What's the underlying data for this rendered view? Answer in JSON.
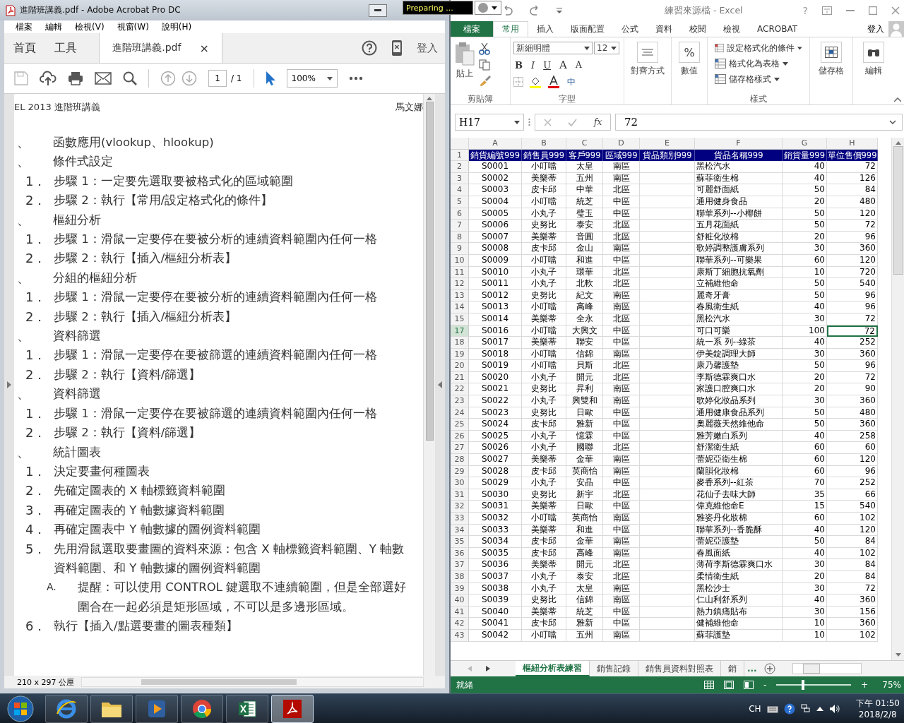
{
  "acrobat": {
    "title": "進階班講義.pdf - Adobe Acrobat Pro DC",
    "menu": [
      "檔案",
      "編輯",
      "檢視(V)",
      "視窗(W)",
      "說明(H)"
    ],
    "tabs": [
      {
        "label": "首頁",
        "selected": false
      },
      {
        "label": "工具",
        "selected": false
      },
      {
        "label": "進階班講義.pdf",
        "selected": true,
        "close": "×"
      }
    ],
    "sign_in": "登入",
    "page_number": "1",
    "page_total": "/ 1",
    "zoom": "100%",
    "page": {
      "header_left": "EL 2013 進階班講義",
      "header_right": "馬文娜",
      "items": [
        {
          "kind": "heading",
          "marker": "、",
          "lines": [
            "函數應用(vlookup、hlookup)"
          ]
        },
        {
          "kind": "heading",
          "marker": "、",
          "lines": [
            "條件式設定"
          ]
        },
        {
          "kind": "step",
          "marker": "1．",
          "lines": [
            "步驟 1：一定要先選取要被格式化的區域範圍"
          ]
        },
        {
          "kind": "step",
          "marker": "2．",
          "lines": [
            "步驟 2：執行【常用/設定格式化的條件】"
          ]
        },
        {
          "kind": "heading",
          "marker": "、",
          "lines": [
            "樞紐分析"
          ]
        },
        {
          "kind": "step",
          "marker": "1．",
          "lines": [
            "步驟 1：滑鼠一定要停在要被分析的連續資料範圍內任何一格"
          ]
        },
        {
          "kind": "step",
          "marker": "2．",
          "lines": [
            "步驟 2：執行【插入/樞紐分析表】"
          ]
        },
        {
          "kind": "heading",
          "marker": "、",
          "lines": [
            "分組的樞紐分析"
          ]
        },
        {
          "kind": "step",
          "marker": "1．",
          "lines": [
            "步驟 1：滑鼠一定要停在要被分析的連續資料範圍內任何一格"
          ]
        },
        {
          "kind": "step",
          "marker": "2．",
          "lines": [
            "步驟 2：執行【插入/樞紐分析表】"
          ]
        },
        {
          "kind": "heading",
          "marker": "、",
          "lines": [
            "資料篩選"
          ]
        },
        {
          "kind": "step",
          "marker": "1．",
          "lines": [
            "步驟 1：滑鼠一定要停在要被篩選的連續資料範圍內任何一格"
          ]
        },
        {
          "kind": "step",
          "marker": "2．",
          "lines": [
            "步驟 2：執行【資料/篩選】"
          ]
        },
        {
          "kind": "heading",
          "marker": "、",
          "lines": [
            "資料篩選"
          ]
        },
        {
          "kind": "step",
          "marker": "1．",
          "lines": [
            "步驟 1：滑鼠一定要停在要被篩選的連續資料範圍內任何一格"
          ]
        },
        {
          "kind": "step",
          "marker": "2．",
          "lines": [
            "步驟 2：執行【資料/篩選】"
          ]
        },
        {
          "kind": "heading",
          "marker": "、",
          "lines": [
            "統計圖表"
          ]
        },
        {
          "kind": "step",
          "marker": "1．",
          "lines": [
            "決定要畫何種圖表"
          ]
        },
        {
          "kind": "step",
          "marker": "2．",
          "lines": [
            "先確定圖表的 X 軸標籤資料範圍"
          ]
        },
        {
          "kind": "step",
          "marker": "3．",
          "lines": [
            "再確定圖表的 Y 軸數據資料範圍"
          ]
        },
        {
          "kind": "step",
          "marker": "4．",
          "lines": [
            "再確定圖表中 Y 軸數據的圖例資料範圍"
          ]
        },
        {
          "kind": "step",
          "marker": "5．",
          "lines": [
            "先用滑鼠選取要畫圖的資料來源：包含 X 軸標籤資料範圍、Y 軸數",
            "資料範圍、和 Y 軸數據的圖例資料範圍"
          ]
        },
        {
          "kind": "note",
          "marker": "A.",
          "lines": [
            "提醒：可以使用 CONTROL 鍵選取不連續範圍，但是全部選好",
            "圍合在一起必須是矩形區域，不可以是多邊形區域。"
          ]
        },
        {
          "kind": "step",
          "marker": "6．",
          "lines": [
            "執行【插入/點選要畫的圖表種類】"
          ]
        }
      ]
    },
    "status": "210 x 297 公厘"
  },
  "tooltip": "Preparing ...",
  "excel": {
    "title": "練習來源檔 - Excel",
    "help": "?",
    "file_tab": "檔案",
    "tabs": [
      {
        "label": "常用",
        "selected": true
      },
      {
        "label": "插入",
        "selected": false
      },
      {
        "label": "版面配置",
        "selected": false
      },
      {
        "label": "公式",
        "selected": false
      },
      {
        "label": "資料",
        "selected": false
      },
      {
        "label": "校閱",
        "selected": false
      },
      {
        "label": "檢視",
        "selected": false
      },
      {
        "label": "ACROBAT",
        "selected": false
      }
    ],
    "sign_in": "登入",
    "ribbon": {
      "paste": "貼上",
      "clipboard_group": "剪貼簿",
      "font_name": "新細明體",
      "font_size": "12",
      "bold": "B",
      "italic": "I",
      "underline": "U",
      "grow": "A",
      "shrink": "A",
      "phonetic": "中",
      "font_group": "字型",
      "align": "對齊方式",
      "number_symbol": "%",
      "number": "數值",
      "styles": [
        "設定格式化的條件",
        "格式化為表格",
        "儲存格樣式"
      ],
      "styles_group": "樣式",
      "cells": "儲存格",
      "editing": "編輯"
    },
    "name_box": "H17",
    "fx": "fx",
    "formula": "72",
    "columns": [
      "A",
      "B",
      "C",
      "D",
      "E",
      "F",
      "G",
      "H"
    ],
    "header": {
      "row": "1",
      "cells": [
        "銷貨編號999",
        "銷售員999",
        "客戶999",
        "區域999",
        "貨品類別999",
        "貨品名稱999",
        "銷貨量999",
        "單位售價999"
      ]
    },
    "rows": [
      {
        "n": "2",
        "id": "S0001",
        "rep": "小叮噹",
        "cust": "太皇",
        "area": "南區",
        "item": "黑松汽水",
        "qty": "40",
        "price": "72",
        "selected": false
      },
      {
        "n": "3",
        "id": "S0002",
        "rep": "美樂蒂",
        "cust": "五州",
        "area": "南區",
        "item": "蘇菲衛生棉",
        "qty": "40",
        "price": "126",
        "selected": false
      },
      {
        "n": "4",
        "id": "S0003",
        "rep": "皮卡邱",
        "cust": "中華",
        "area": "北區",
        "item": "可麗舒面紙",
        "qty": "50",
        "price": "84",
        "selected": false
      },
      {
        "n": "5",
        "id": "S0004",
        "rep": "小叮噹",
        "cust": "統芝",
        "area": "中區",
        "item": "通用健身食品",
        "qty": "20",
        "price": "480",
        "selected": false
      },
      {
        "n": "6",
        "id": "S0005",
        "rep": "小丸子",
        "cust": "璧玉",
        "area": "中區",
        "item": "聯華系列--小椰餅",
        "qty": "50",
        "price": "120",
        "selected": false
      },
      {
        "n": "7",
        "id": "S0006",
        "rep": "史努比",
        "cust": "泰安",
        "area": "北區",
        "item": "五月花面紙",
        "qty": "50",
        "price": "72",
        "selected": false
      },
      {
        "n": "8",
        "id": "S0007",
        "rep": "美樂蒂",
        "cust": "音圓",
        "area": "北區",
        "item": "舒粧化妝棉",
        "qty": "20",
        "price": "96",
        "selected": false
      },
      {
        "n": "9",
        "id": "S0008",
        "rep": "皮卡邱",
        "cust": "金山",
        "area": "南區",
        "item": "歌婷調整護膚系列",
        "qty": "30",
        "price": "360",
        "selected": false
      },
      {
        "n": "10",
        "id": "S0009",
        "rep": "小叮噹",
        "cust": "和進",
        "area": "中區",
        "item": "聯華系列--可樂果",
        "qty": "60",
        "price": "120",
        "selected": false
      },
      {
        "n": "11",
        "id": "S0010",
        "rep": "小丸子",
        "cust": "環華",
        "area": "北區",
        "item": "康斯丁細胞抗氧劑",
        "qty": "10",
        "price": "720",
        "selected": false
      },
      {
        "n": "12",
        "id": "S0011",
        "rep": "小丸子",
        "cust": "北軟",
        "area": "北區",
        "item": "立補維他命",
        "qty": "50",
        "price": "540",
        "selected": false
      },
      {
        "n": "13",
        "id": "S0012",
        "rep": "史努比",
        "cust": "紀文",
        "area": "南區",
        "item": "麗奇牙膏",
        "qty": "50",
        "price": "96",
        "selected": false
      },
      {
        "n": "14",
        "id": "S0013",
        "rep": "小叮噹",
        "cust": "高峰",
        "area": "南區",
        "item": "春風衛生紙",
        "qty": "40",
        "price": "96",
        "selected": false
      },
      {
        "n": "15",
        "id": "S0014",
        "rep": "美樂蒂",
        "cust": "全永",
        "area": "北區",
        "item": "黑松汽水",
        "qty": "30",
        "price": "72",
        "selected": false
      },
      {
        "n": "17",
        "id": "S0016",
        "rep": "小叮噹",
        "cust": "大興文",
        "area": "中區",
        "item": "可口可樂",
        "qty": "100",
        "price": "72",
        "selected": true
      },
      {
        "n": "18",
        "id": "S0017",
        "rep": "美樂蒂",
        "cust": "聯安",
        "area": "中區",
        "item": "統一系 列--綠茶",
        "qty": "40",
        "price": "252",
        "selected": false
      },
      {
        "n": "19",
        "id": "S0018",
        "rep": "小叮噹",
        "cust": "信錦",
        "area": "南區",
        "item": "伊美錠調理大師",
        "qty": "30",
        "price": "360",
        "selected": false
      },
      {
        "n": "20",
        "id": "S0019",
        "rep": "小叮噹",
        "cust": "貝斯",
        "area": "北區",
        "item": "康乃馨護墊",
        "qty": "50",
        "price": "96",
        "selected": false
      },
      {
        "n": "21",
        "id": "S0020",
        "rep": "小丸子",
        "cust": "開元",
        "area": "北區",
        "item": "李斯德霖爽口水",
        "qty": "20",
        "price": "72",
        "selected": false
      },
      {
        "n": "22",
        "id": "S0021",
        "rep": "史努比",
        "cust": "昇利",
        "area": "南區",
        "item": "家護口腔爽口水",
        "qty": "20",
        "price": "90",
        "selected": false
      },
      {
        "n": "23",
        "id": "S0022",
        "rep": "小丸子",
        "cust": "興雙和",
        "area": "南區",
        "item": "歌婷化妝品系列",
        "qty": "30",
        "price": "360",
        "selected": false
      },
      {
        "n": "24",
        "id": "S0023",
        "rep": "史努比",
        "cust": "日歐",
        "area": "中區",
        "item": "通用健康食品系列",
        "qty": "50",
        "price": "480",
        "selected": false
      },
      {
        "n": "25",
        "id": "S0024",
        "rep": "皮卡邱",
        "cust": "雅新",
        "area": "中區",
        "item": "奧麗薇天然維他命",
        "qty": "50",
        "price": "360",
        "selected": false
      },
      {
        "n": "26",
        "id": "S0025",
        "rep": "小丸子",
        "cust": "憶霖",
        "area": "中區",
        "item": "雅芳嫩白系列",
        "qty": "40",
        "price": "258",
        "selected": false
      },
      {
        "n": "27",
        "id": "S0026",
        "rep": "小丸子",
        "cust": "國聯",
        "area": "北區",
        "item": "舒潔衛生紙",
        "qty": "60",
        "price": "60",
        "selected": false
      },
      {
        "n": "28",
        "id": "S0027",
        "rep": "美樂蒂",
        "cust": "金華",
        "area": "南區",
        "item": "蕾妮亞衛生棉",
        "qty": "60",
        "price": "120",
        "selected": false
      },
      {
        "n": "29",
        "id": "S0028",
        "rep": "皮卡邱",
        "cust": "英商怡",
        "area": "南區",
        "item": "蘭韻化妝棉",
        "qty": "60",
        "price": "96",
        "selected": false
      },
      {
        "n": "30",
        "id": "S0029",
        "rep": "小丸子",
        "cust": "安晶",
        "area": "中區",
        "item": "麥香系列--紅茶",
        "qty": "70",
        "price": "252",
        "selected": false
      },
      {
        "n": "31",
        "id": "S0030",
        "rep": "史努比",
        "cust": "新宇",
        "area": "北區",
        "item": "花仙子去味大師",
        "qty": "35",
        "price": "66",
        "selected": false
      },
      {
        "n": "32",
        "id": "S0031",
        "rep": "美樂蒂",
        "cust": "日歐",
        "area": "中區",
        "item": "偉克維他命E",
        "qty": "15",
        "price": "540",
        "selected": false
      },
      {
        "n": "33",
        "id": "S0032",
        "rep": "小叮噹",
        "cust": "英商怡",
        "area": "南區",
        "item": "雅姿丹化妝棉",
        "qty": "60",
        "price": "102",
        "selected": false
      },
      {
        "n": "34",
        "id": "S0033",
        "rep": "美樂蒂",
        "cust": "和進",
        "area": "中區",
        "item": "聯華系列--香脆酥",
        "qty": "40",
        "price": "120",
        "selected": false
      },
      {
        "n": "35",
        "id": "S0034",
        "rep": "皮卡邱",
        "cust": "金華",
        "area": "南區",
        "item": "蕾妮亞護墊",
        "qty": "50",
        "price": "84",
        "selected": false
      },
      {
        "n": "36",
        "id": "S0035",
        "rep": "皮卡邱",
        "cust": "高峰",
        "area": "南區",
        "item": "春風面紙",
        "qty": "40",
        "price": "102",
        "selected": false
      },
      {
        "n": "37",
        "id": "S0036",
        "rep": "美樂蒂",
        "cust": "開元",
        "area": "北區",
        "item": "薄荷李斯德霖爽口水",
        "qty": "30",
        "price": "84",
        "selected": false
      },
      {
        "n": "38",
        "id": "S0037",
        "rep": "小丸子",
        "cust": "泰安",
        "area": "北區",
        "item": "柔情衛生紙",
        "qty": "20",
        "price": "84",
        "selected": false
      },
      {
        "n": "39",
        "id": "S0038",
        "rep": "小丸子",
        "cust": "太皇",
        "area": "南區",
        "item": "黑松沙士",
        "qty": "30",
        "price": "72",
        "selected": false
      },
      {
        "n": "40",
        "id": "S0039",
        "rep": "史努比",
        "cust": "信錦",
        "area": "南區",
        "item": "仁山利舒系列",
        "qty": "40",
        "price": "360",
        "selected": false
      },
      {
        "n": "41",
        "id": "S0040",
        "rep": "美樂蒂",
        "cust": "統芝",
        "area": "中區",
        "item": "熱力鎮痛貼布",
        "qty": "30",
        "price": "156",
        "selected": false
      },
      {
        "n": "42",
        "id": "S0041",
        "rep": "皮卡邱",
        "cust": "雅新",
        "area": "中區",
        "item": "健補維他命",
        "qty": "10",
        "price": "360",
        "selected": false
      },
      {
        "n": "43",
        "id": "S0042",
        "rep": "小叮噹",
        "cust": "五州",
        "area": "南區",
        "item": "蘇菲護墊",
        "qty": "10",
        "price": "102",
        "selected": false
      }
    ],
    "sheets": [
      {
        "label": "樞紐分析表練習",
        "selected": true
      },
      {
        "label": "銷售記錄",
        "selected": false
      },
      {
        "label": "銷售員資料對照表",
        "selected": false
      },
      {
        "label": "銷",
        "selected": false
      }
    ],
    "more_sheets": "...",
    "status": "就緒",
    "zoom_out": "-",
    "zoom_in": "+",
    "zoom_slider": {
      "level": 0.36
    },
    "zoom": "75%"
  },
  "taskbar": {
    "apps": [
      {
        "kind": "browser",
        "selected": false
      },
      {
        "kind": "folder",
        "selected": false
      },
      {
        "kind": "media",
        "selected": false
      },
      {
        "kind": "chrome",
        "selected": false
      },
      {
        "kind": "excel",
        "selected": false
      },
      {
        "kind": "acrobat",
        "selected": true
      }
    ],
    "language": "CH",
    "time": "下午 01:50",
    "date": "2018/2/8"
  }
}
